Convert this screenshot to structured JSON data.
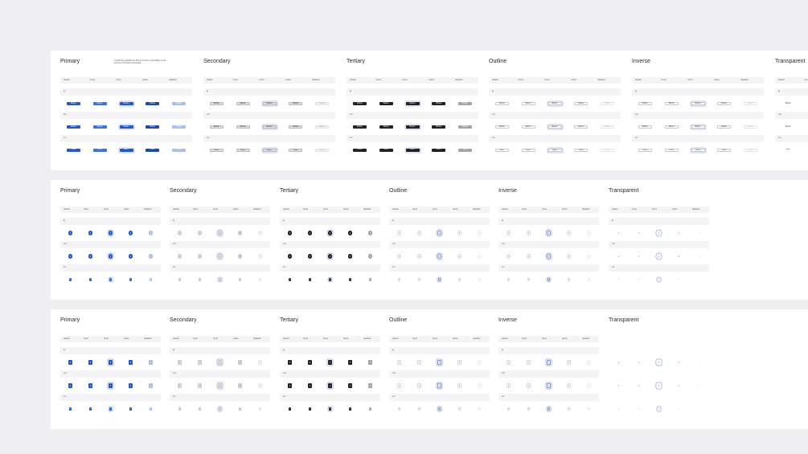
{
  "colors": {
    "background": "#efeff1",
    "panel": "#ffffff",
    "primary": "#1f5ad4",
    "primary_disabled": "#a6c0ec",
    "tertiary": "#222226",
    "tertiary_disabled": "#a3a3a8",
    "secondary_fill": "#dedee3",
    "focus_ring": "#7e95d9",
    "outline_border": "#c8c8ce",
    "muted": "#c4c4ca"
  },
  "columns": [
    "default",
    "hover",
    "focus",
    "active",
    "disabled"
  ],
  "sizes": [
    "lg",
    "md",
    "sm"
  ],
  "button_label": "Button",
  "note": "Check this guideline to find out if there is flexibility to the amount of content presented.",
  "panels": [
    {
      "kind": "buttons",
      "groups": [
        {
          "title": "Primary",
          "variant": "primary"
        },
        {
          "title": "Secondary",
          "variant": "secondary"
        },
        {
          "title": "Tertiary",
          "variant": "tertiary"
        },
        {
          "title": "Outline",
          "variant": "outline"
        },
        {
          "title": "Inverse",
          "variant": "inverse"
        },
        {
          "title": "Transparent",
          "variant": "transparent"
        }
      ]
    },
    {
      "kind": "icon-circle",
      "groups": [
        {
          "title": "Primary",
          "variant": "primary"
        },
        {
          "title": "Secondary",
          "variant": "secondary"
        },
        {
          "title": "Tertiary",
          "variant": "tertiary"
        },
        {
          "title": "Outline",
          "variant": "outline"
        },
        {
          "title": "Inverse",
          "variant": "inverse"
        },
        {
          "title": "Transparent",
          "variant": "transparent"
        }
      ]
    },
    {
      "kind": "icon-square",
      "groups": [
        {
          "title": "Primary",
          "variant": "primary"
        },
        {
          "title": "Secondary",
          "variant": "secondary"
        },
        {
          "title": "Tertiary",
          "variant": "tertiary"
        },
        {
          "title": "Outline",
          "variant": "outline"
        },
        {
          "title": "Inverse",
          "variant": "inverse"
        },
        {
          "title": "Transparent",
          "variant": "transparent"
        }
      ]
    }
  ]
}
